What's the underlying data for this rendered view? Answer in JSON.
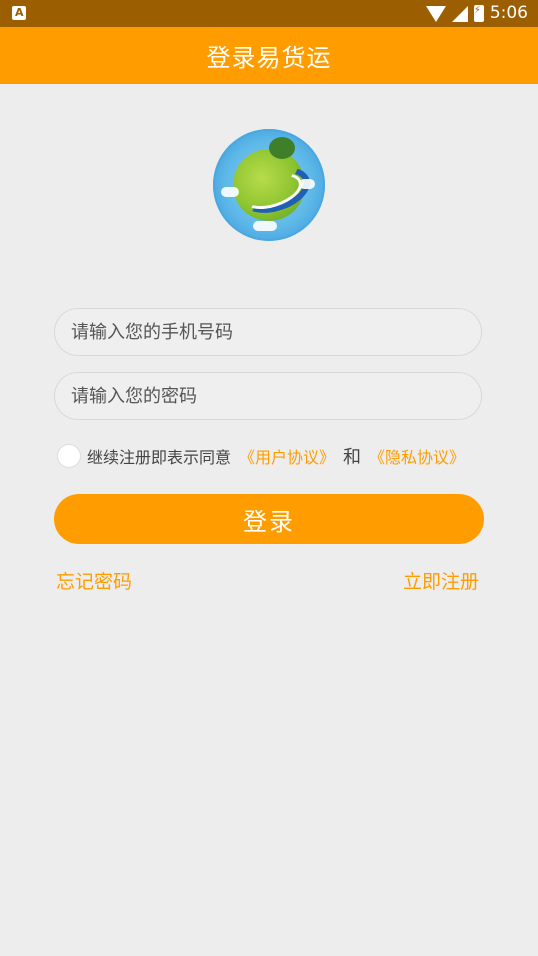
{
  "status_bar": {
    "time": "5:06",
    "icons": [
      "notification-icon",
      "wifi-icon",
      "signal-icon",
      "battery-icon"
    ]
  },
  "header": {
    "title": "登录易货运"
  },
  "form": {
    "phone_placeholder": "请输入您的手机号码",
    "password_placeholder": "请输入您的密码",
    "agree_text": "继续注册即表示同意",
    "user_agreement": "《用户协议》",
    "and_text": "和",
    "privacy_agreement": "《隐私协议》",
    "agree_checked": false,
    "login_label": "登录",
    "forgot_password": "忘记密码",
    "register_now": "立即注册"
  },
  "colors": {
    "accent": "#ff9d00",
    "status_bar": "#9b5e00",
    "background": "#ededed"
  }
}
